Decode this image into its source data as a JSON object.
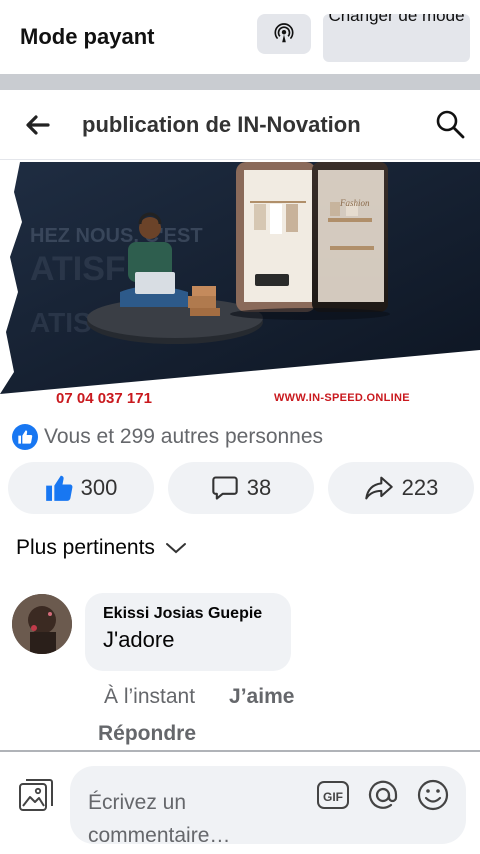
{
  "topbar": {
    "mode_title": "Mode payant",
    "change_mode_label": "Changer de mode"
  },
  "header": {
    "title": "publication de IN-Novation"
  },
  "post": {
    "image_text": {
      "phone": "07 04 037 171",
      "website": "WWW.IN-SPEED.ONLINE"
    },
    "reactions_text": "Vous et 299 autres personnes",
    "actions": {
      "likes": "300",
      "comments": "38",
      "shares": "223"
    }
  },
  "comments": {
    "sort_label": "Plus pertinents",
    "items": [
      {
        "author": "Ekissi Josias Guepie",
        "text": "J'adore",
        "time": "À l’instant",
        "like_label": "J’aime",
        "reply_label": "Répondre"
      }
    ]
  },
  "composer": {
    "placeholder": "Écrivez un commentaire…"
  },
  "colors": {
    "accent": "#1877f2",
    "pill_bg": "#f0f2f5",
    "secondary_text": "#65676b",
    "image_red": "#c9191e"
  },
  "icons": [
    "broadcast-icon",
    "back-arrow-icon",
    "search-icon",
    "like-icon",
    "comment-icon",
    "share-icon",
    "chevron-down-icon",
    "gallery-icon",
    "gif-icon",
    "at-icon",
    "emoji-icon"
  ]
}
